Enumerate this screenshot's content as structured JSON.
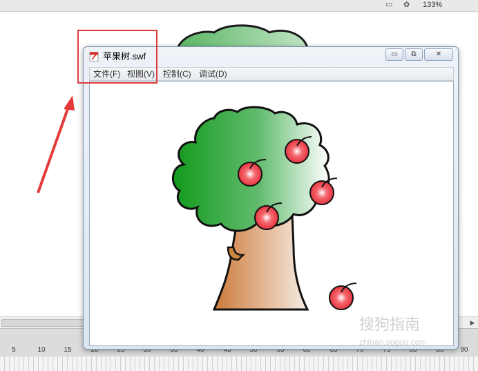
{
  "toolbar": {
    "zoom": "133%"
  },
  "window": {
    "title": "苹果树.swf",
    "menu": [
      "文件(F)",
      "视图(V)",
      "控制(C)",
      "调试(D)"
    ],
    "controls": {
      "minimize": "▭",
      "restore": "⧉",
      "close": "✕"
    }
  },
  "timeline": {
    "ruler": [
      "5",
      "10",
      "15",
      "20",
      "25",
      "30",
      "35",
      "40",
      "45",
      "50",
      "55",
      "60",
      "65",
      "70",
      "75",
      "80",
      "85",
      "90"
    ]
  },
  "watermark": {
    "brand": "搜狗指南",
    "url": "zhinan.sogou.com"
  },
  "colors": {
    "highlight": "#e03c3c",
    "foliage": "#1f9a2c",
    "apple": "#e5313a",
    "trunk": "#cf8a57"
  }
}
